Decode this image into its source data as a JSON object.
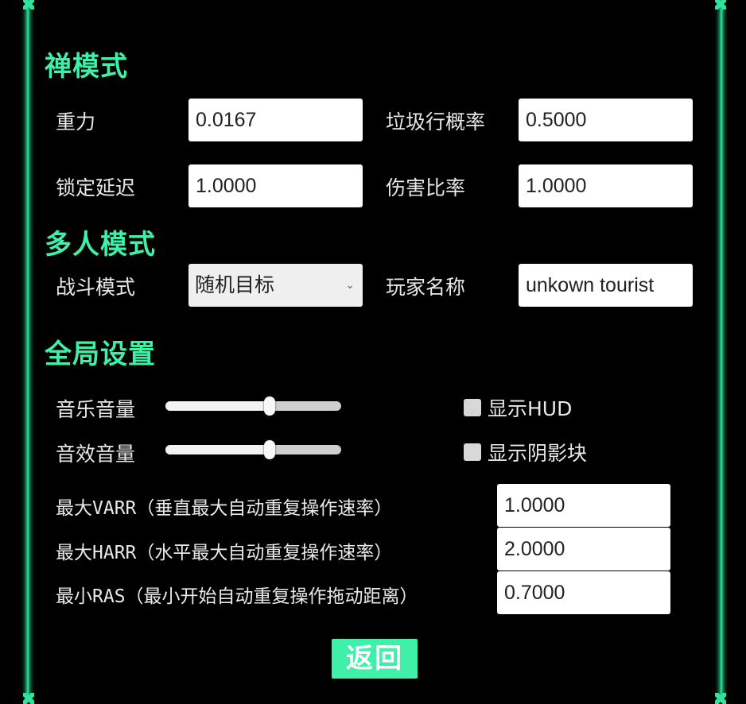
{
  "sections": {
    "zen": {
      "title": "禅模式",
      "gravity_label": "重力",
      "gravity_value": "0.0167",
      "garbage_label": "垃圾行概率",
      "garbage_value": "0.5000",
      "lock_delay_label": "锁定延迟",
      "lock_delay_value": "1.0000",
      "damage_label": "伤害比率",
      "damage_value": "1.0000"
    },
    "multi": {
      "title": "多人模式",
      "battle_label": "战斗模式",
      "battle_value": "随机目标",
      "player_name_label": "玩家名称",
      "player_name_value": "unkown tourist"
    },
    "global": {
      "title": "全局设置",
      "music_label": "音乐音量",
      "music_level": 0.6,
      "sfx_label": "音效音量",
      "sfx_level": 0.6,
      "show_hud_label": "显示HUD",
      "show_ghost_label": "显示阴影块",
      "varr_label": "最大VARR（垂直最大自动重复操作速率）",
      "varr_value": "1.0000",
      "harr_label": "最大HARR（水平最大自动重复操作速率）",
      "harr_value": "2.0000",
      "ras_label": "最小RAS（最小开始自动重复操作拖动距离）",
      "ras_value": "0.7000"
    }
  },
  "back_label": "返回",
  "colors": {
    "accent": "#3ef0a8",
    "background": "#000000",
    "rail": "#2ee39b"
  }
}
